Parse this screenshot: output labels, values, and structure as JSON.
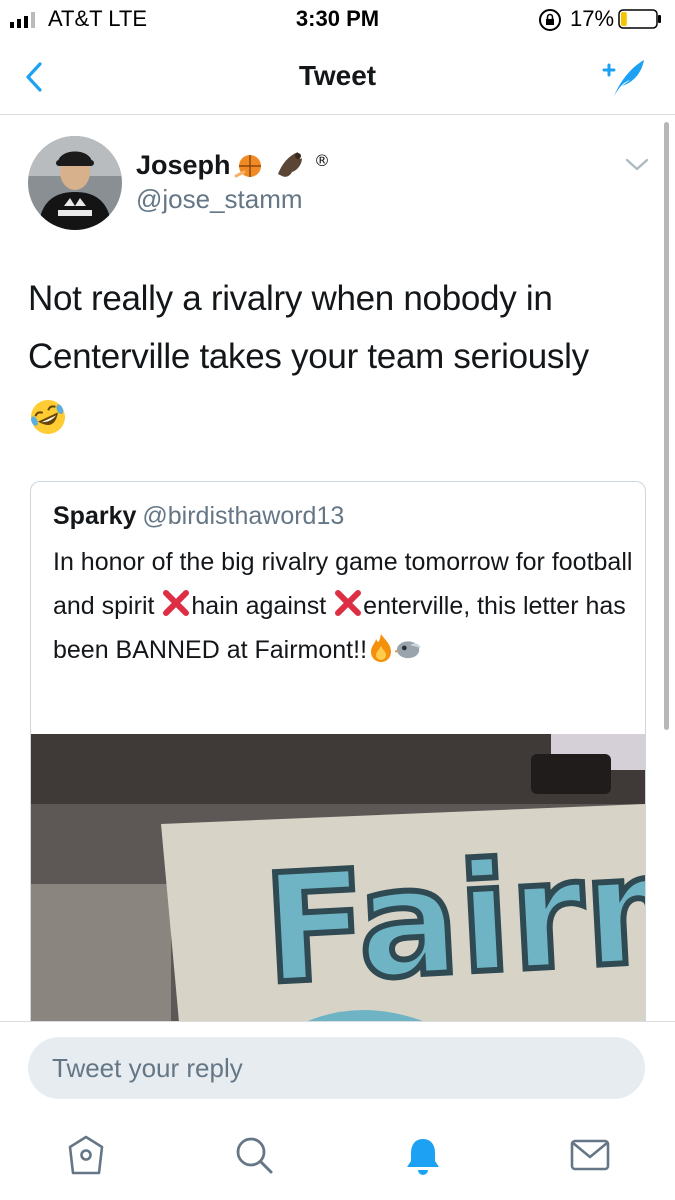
{
  "status_bar": {
    "carrier": "AT&T  LTE",
    "time": "3:30 PM",
    "battery_percent": "17%",
    "battery_level": 0.17,
    "icons": [
      "signal-bars-icon",
      "orientation-lock-icon",
      "battery-icon"
    ]
  },
  "nav": {
    "title": "Tweet",
    "back_icon": "chevron-left-icon",
    "compose_icon": "compose-feather-icon"
  },
  "tweet": {
    "author_name": "Joseph",
    "author_handle": "@jose_stamm",
    "badges": [
      "basketball-emoji",
      "bat-emoji",
      "registered-sign"
    ],
    "registered": "®",
    "text_line1": "Not really a rivalry when nobody in",
    "text_line2": "Centerville takes your team seriously",
    "trailing_emoji": "rolling-on-floor-laughing-emoji"
  },
  "quoted_tweet": {
    "name": "Sparky",
    "handle": "@birdisthaword13",
    "text_part1": "In honor of the big rivalry game tomorrow for football and spirit ",
    "text_part2": "hain against ",
    "text_part3": "enterville, this letter has been BANNED at Fairmont!!",
    "media_caption": "Fairm"
  },
  "reply": {
    "placeholder": "Tweet your reply"
  },
  "tab_bar": {
    "tabs": [
      "home-icon",
      "search-icon",
      "notifications-bell-icon",
      "messages-envelope-icon"
    ],
    "active_tab": "notifications-bell-icon"
  },
  "colors": {
    "accent": "#1da1f2",
    "text": "#14171a",
    "secondary": "#657786",
    "battery_low": "#f5c400"
  }
}
